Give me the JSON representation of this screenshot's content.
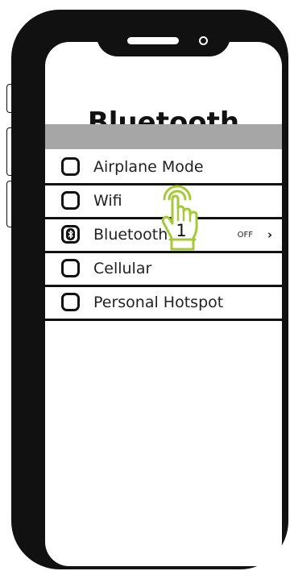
{
  "screen": {
    "title": "Bluetooth"
  },
  "settings_list": [
    {
      "label": "Airplane Mode",
      "icon": "empty-square-icon"
    },
    {
      "label": "Wifi",
      "icon": "empty-square-icon"
    },
    {
      "label": "Bluetooth",
      "icon": "bluetooth-icon",
      "status": "OFF",
      "chevron": "›"
    },
    {
      "label": "Cellular",
      "icon": "empty-square-icon"
    },
    {
      "label": "Personal Hotspot",
      "icon": "empty-square-icon"
    }
  ],
  "tap_indicator": {
    "step": "1",
    "icon": "tap-hand-icon",
    "color": "#a6c93a"
  },
  "colors": {
    "frame": "#111111",
    "header_bar": "#a6a6a6",
    "background": "#ffffff"
  }
}
